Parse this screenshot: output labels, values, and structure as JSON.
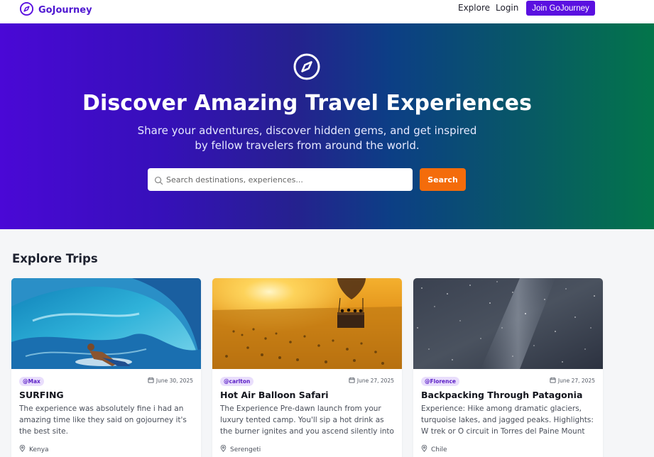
{
  "nav": {
    "brand": "GoJourney",
    "links": [
      "Explore",
      "Login"
    ],
    "join_label": "Join GoJourney"
  },
  "hero": {
    "title": "Discover Amazing Travel Experiences",
    "subtitle": "Share your adventures, discover hidden gems, and get inspired by fellow travelers from around the world.",
    "search_placeholder": "Search destinations, experiences...",
    "search_button": "Search"
  },
  "section": {
    "title": "Explore Trips"
  },
  "cards": [
    {
      "user": "@Max",
      "date": "June 30, 2025",
      "title": "SURFING",
      "description": "The experience was absolutely fine i had an amazing time like they said on gojourney it's the best site.",
      "location": "Kenya"
    },
    {
      "user": "@carlton",
      "date": "June 27, 2025",
      "title": "Hot Air Balloon Safari",
      "description": "The Experience Pre-dawn launch from your luxury tented camp. You'll sip a hot drink as the burner ignites and you ascend silently into the vastness…",
      "location": "Serengeti"
    },
    {
      "user": "@Florence",
      "date": "June 27, 2025",
      "title": "Backpacking Through Patagonia",
      "description": "Experience: Hike among dramatic glaciers, turquoise lakes, and jagged peaks. Highlights: W trek or O circuit in Torres del Paine Mount Fitz R…",
      "location": "Chile"
    }
  ],
  "colors": {
    "brand": "#5a10e0",
    "accent": "#f46c0b",
    "tag_bg": "#e9defc"
  }
}
